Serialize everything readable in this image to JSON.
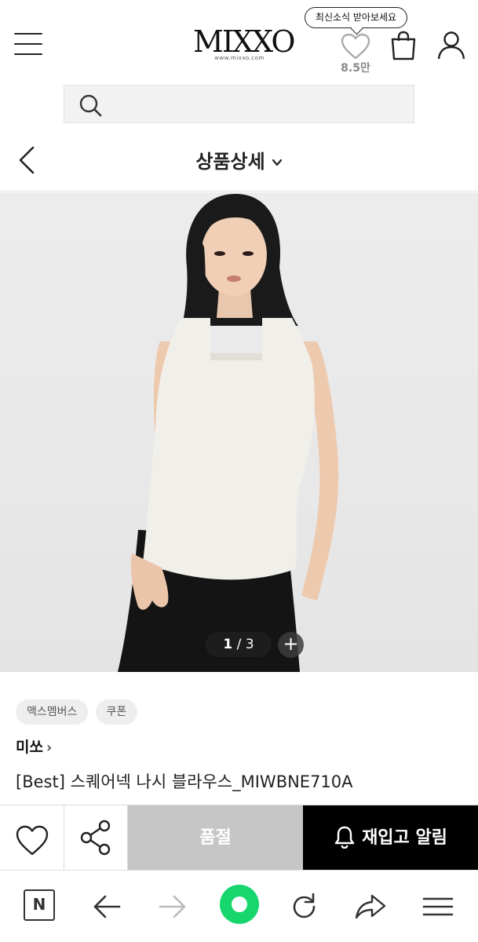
{
  "header": {
    "logo": "MIXXO",
    "logo_sub": "www.mixxo.com",
    "news_bubble": "최신소식 받아보세요",
    "like_count": "8.5만"
  },
  "titlebar": {
    "title": "상품상세"
  },
  "gallery": {
    "current": "1",
    "separator": "/",
    "total": "3",
    "plus": "+"
  },
  "product": {
    "chips": [
      "맥스멤버스",
      "쿠폰"
    ],
    "brand": "미쏘",
    "brand_arrow": "›",
    "name": "[Best] 스퀘어넥 나시 블라우스_MIWBNE710A"
  },
  "actions": {
    "soldout_label": "품절",
    "restock_label": "재입고 알림"
  },
  "browser": {
    "n_label": "N"
  },
  "colors": {
    "soldout_bg": "#c6c6c6",
    "restock_bg": "#000000",
    "browser_green": "#17d66e"
  }
}
